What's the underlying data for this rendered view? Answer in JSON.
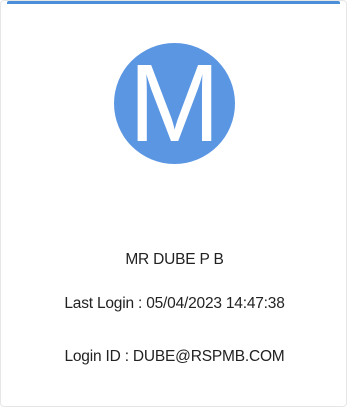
{
  "profile": {
    "avatar_letter": "M",
    "avatar_color": "#5b96e3",
    "accent_color": "#4a8fd8",
    "name": "MR DUBE P B",
    "last_login": "Last Login : 05/04/2023 14:47:38",
    "login_id": "Login ID : DUBE@RSPMB.COM"
  }
}
